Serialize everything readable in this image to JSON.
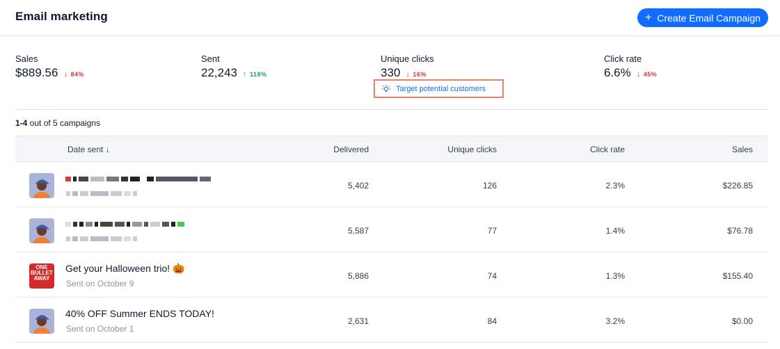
{
  "header": {
    "title": "Email marketing",
    "create_button": "Create Email Campaign",
    "create_icon": "plus-icon"
  },
  "stats": [
    {
      "label": "Sales",
      "value": "$889.56",
      "trend": "84%",
      "direction": "down"
    },
    {
      "label": "Sent",
      "value": "22,243",
      "trend": "118%",
      "direction": "up"
    },
    {
      "label": "Unique clicks",
      "value": "330",
      "trend": "16%",
      "direction": "down"
    },
    {
      "label": "Click rate",
      "value": "6.6%",
      "trend": "45%",
      "direction": "down"
    }
  ],
  "target_link": {
    "label": "Target potential customers",
    "icon": "lightbulb-icon"
  },
  "campaign_count": {
    "range": "1-4",
    "rest": " out of 5 campaigns"
  },
  "colors": {
    "accent": "#116dff",
    "down": "#e0343c",
    "up": "#27a348",
    "highlight_border": "#f07e68"
  },
  "table": {
    "columns": {
      "date": "Date sent ↓",
      "delivered": "Delivered",
      "unique_clicks": "Unique clicks",
      "click_rate": "Click rate",
      "sales": "Sales"
    },
    "rows": [
      {
        "name": "[redacted]",
        "sub": "[redacted]",
        "thumb": "avatar",
        "delivered": "5,402",
        "unique_clicks": "126",
        "click_rate": "2.3%",
        "sales": "$226.85"
      },
      {
        "name": "[redacted]",
        "sub": "[redacted]",
        "thumb": "avatar",
        "delivered": "5,587",
        "unique_clicks": "77",
        "click_rate": "1.4%",
        "sales": "$76.78"
      },
      {
        "name": "Get your Halloween trio! 🎃",
        "sub": "Sent on October 9",
        "thumb": "book-cover",
        "thumb_text": [
          "ONE",
          "BULLET",
          "AWAY"
        ],
        "delivered": "5,886",
        "unique_clicks": "74",
        "click_rate": "1.3%",
        "sales": "$155.40"
      },
      {
        "name": "40% OFF Summer ENDS TODAY!",
        "sub": "Sent on October 1",
        "thumb": "avatar",
        "delivered": "2,631",
        "unique_clicks": "84",
        "click_rate": "3.2%",
        "sales": "$0.00"
      }
    ]
  }
}
